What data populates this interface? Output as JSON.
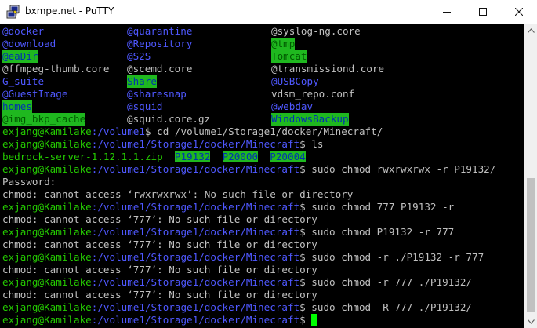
{
  "window": {
    "title": "bxmpe.net - PuTTY"
  },
  "icons": {
    "app": "putty-icon",
    "minimize": "minimize-icon",
    "maximize": "maximize-icon",
    "close": "close-icon",
    "scroll_up": "chevron-up-icon",
    "scroll_down": "chevron-down-icon"
  },
  "colors": {
    "prompt_user": "#24c900",
    "prompt_path": "#4f58ff",
    "text": "#c0c0c0",
    "highlight": "#1fb81f",
    "cursor": "#00ff00"
  },
  "terminal": {
    "listing": [
      [
        "@docker",
        "@quarantine",
        "@syslog-ng.core"
      ],
      [
        "@download",
        "@Repository",
        "@tmp"
      ],
      [
        "@eaDir",
        "@S2S",
        "Tomcat"
      ],
      [
        "@ffmpeg-thumb.core",
        "@scemd.core",
        "@transmissiond.core"
      ],
      [
        "G_suite",
        "Share",
        "@USBCopy"
      ],
      [
        "@GuestImage",
        "@sharesnap",
        "vdsm_repo.conf"
      ],
      [
        "homes",
        "@squid",
        "@webdav"
      ],
      [
        "@img_bkp_cache",
        "@squid.core.gz",
        "WindowsBackup"
      ]
    ],
    "prompt_user": "exjang@Kamilake",
    "path_volume": ":/volume1",
    "path_minecraft": ":/volume1/Storage1/docker/Minecraft",
    "prompt_suffix": "$ ",
    "cmd_cd": "cd /volume1/Storage1/docker/Minecraft/",
    "cmd_ls": "ls",
    "ls_output": [
      "bedrock-server-1.12.1.1.zip",
      "P19132",
      "P20000",
      "P20004"
    ],
    "cmd1": "sudo chmod rwxrwxrwx -r P19132/",
    "password": "Password:",
    "err1": "chmod: cannot access ‘rwxrwxrwx’: No such file or directory",
    "cmd2": "sudo chmod 777 P19132 -r",
    "err_777": "chmod: cannot access ‘777’: No such file or directory",
    "cmd3": "sudo chmod P19132 -r 777",
    "cmd4": "sudo chmod -r ./P19132 -r 777",
    "cmd5": "sudo chmod -r 777 ./P19132/",
    "cmd6": "sudo chmod -R 777 ./P19132/"
  }
}
